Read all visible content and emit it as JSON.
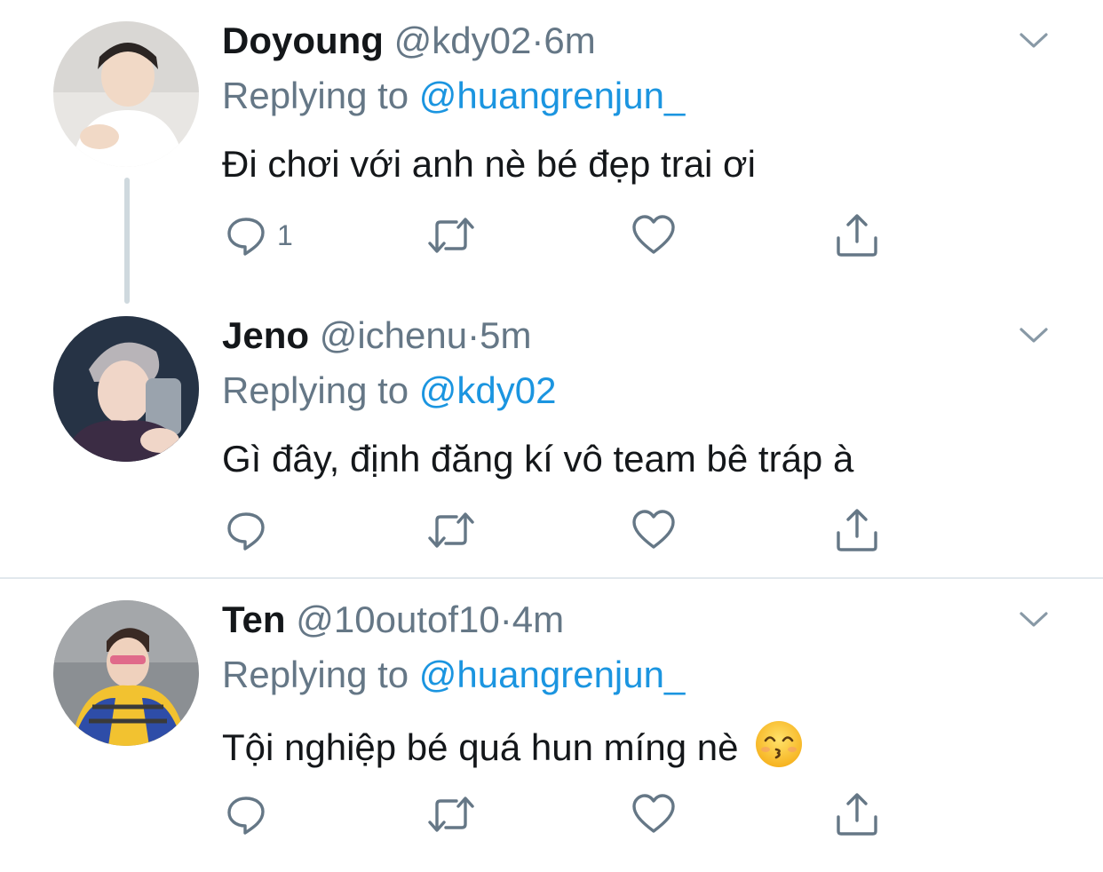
{
  "reply_prefix": "Replying to",
  "separator": "·",
  "tweets": [
    {
      "name": "Doyoung",
      "handle": "@kdy02",
      "time": "6m",
      "replying_to": "@huangrenjun_",
      "text": "Đi chơi với anh nè bé đẹp trai ơi",
      "reply_count": "1",
      "avatar_icon": "avatar-photo"
    },
    {
      "name": "Jeno",
      "handle": "@ichenu",
      "time": "5m",
      "replying_to": "@kdy02",
      "text": "Gì đây, định đăng kí vô team bê tráp à",
      "reply_count": "",
      "avatar_icon": "avatar-photo"
    },
    {
      "name": "Ten",
      "handle": "@10outof10",
      "time": "4m",
      "replying_to": "@huangrenjun_",
      "text": "Tội nghiệp bé quá hun míng nè",
      "emoji": "kissing-face-emoji",
      "reply_count": "",
      "avatar_icon": "avatar-photo"
    }
  ],
  "colors": {
    "link": "#1b95e0",
    "muted": "#657786",
    "text": "#14171a",
    "thread_line": "#cfd9de",
    "divider": "#e1e8ed"
  },
  "icons": [
    "reply-icon",
    "retweet-icon",
    "like-icon",
    "share-icon",
    "chevron-down-icon"
  ]
}
